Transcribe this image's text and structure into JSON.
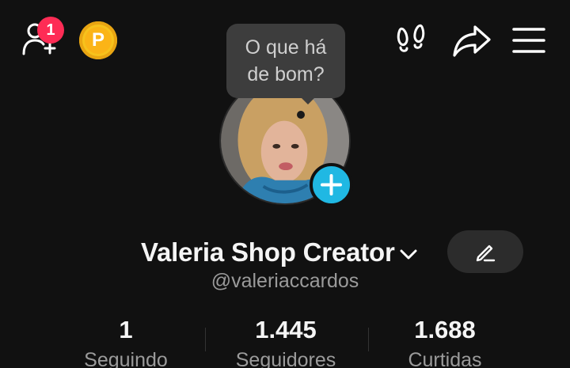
{
  "topbar": {
    "friend_requests_badge": "1",
    "coin_label": "P"
  },
  "tooltip": {
    "line1": "O que há",
    "line2": "de bom?"
  },
  "profile": {
    "display_name": "Valeria Shop Creator",
    "username": "@valeriaccardos"
  },
  "stats": [
    {
      "value": "1",
      "label": "Seguindo"
    },
    {
      "value": "1.445",
      "label": "Seguidores"
    },
    {
      "value": "1.688",
      "label": "Curtidas"
    }
  ],
  "colors": {
    "background": "#111111",
    "badge": "#fe2c55",
    "coin": "#f7c21c",
    "add_avatar": "#20b8e3",
    "secondary_text": "#9b9b9b"
  },
  "icons": [
    "add-friend-icon",
    "coin-icon",
    "footprints-icon",
    "share-icon",
    "menu-icon",
    "chevron-down-icon",
    "pencil-icon",
    "plus-icon"
  ]
}
